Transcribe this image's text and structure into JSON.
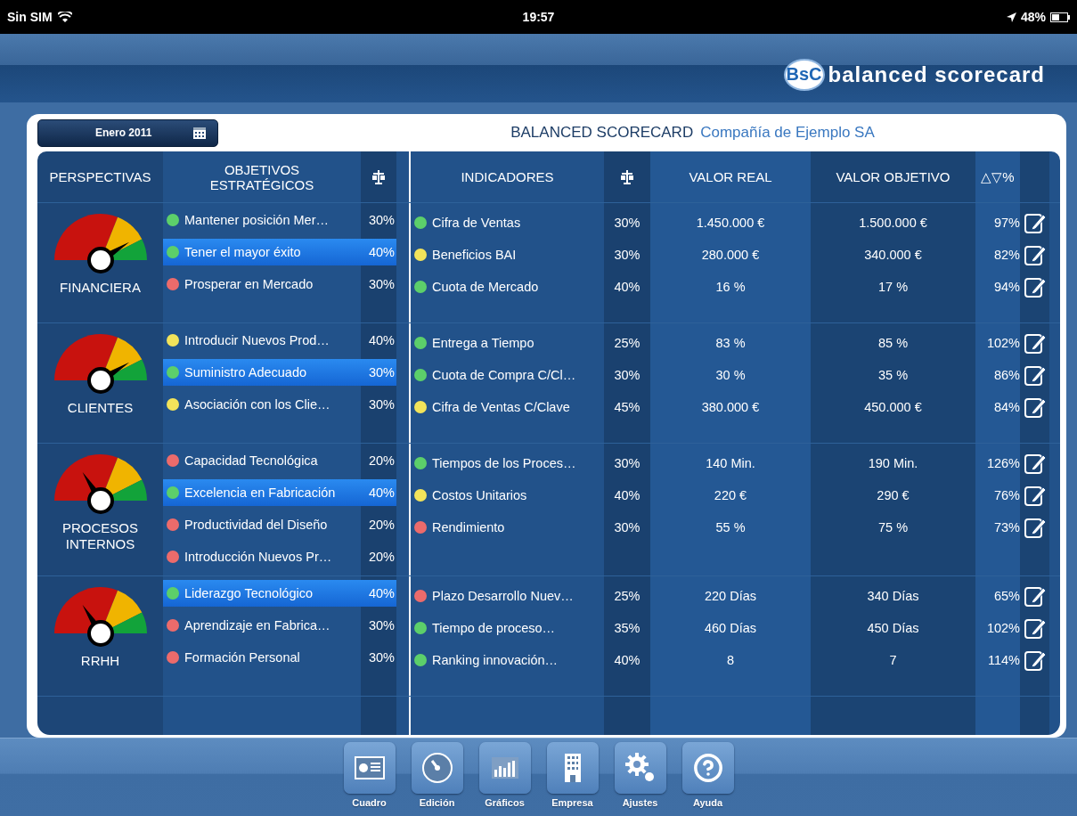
{
  "status_bar": {
    "carrier": "Sin SIM",
    "time": "19:57",
    "battery": "48%"
  },
  "header": {
    "logo_badge": "BsC",
    "logo_text": "balanced scorecard"
  },
  "date_button": "Enero 2011",
  "title": {
    "main": "BALANCED SCORECARD",
    "company": "Compañía de Ejemplo SA"
  },
  "columns": {
    "perspectives": "PERSPECTIVAS",
    "objectives": "OBJETIVOS ESTRATÉGICOS",
    "indicators": "INDICADORES",
    "real": "VALOR REAL",
    "target": "VALOR OBJETIVO",
    "delta": "△▽%"
  },
  "groups": [
    {
      "perspective": "FINANCIERA",
      "kind": "high",
      "objectives": [
        {
          "name": "Mantener posición Mer…",
          "weight": "30%",
          "color": "#5ccf6a",
          "selected": false
        },
        {
          "name": "Tener el mayor éxito",
          "weight": "40%",
          "color": "#5ccf6a",
          "selected": true
        },
        {
          "name": "Prosperar en Mercado",
          "weight": "30%",
          "color": "#ec6b6b",
          "selected": false
        }
      ],
      "indicators": [
        {
          "name": "Cifra de Ventas",
          "weight": "30%",
          "real": "1.450.000 €",
          "target": "1.500.000 €",
          "pct": "97%",
          "color": "#5ccf6a"
        },
        {
          "name": "Beneficios BAI",
          "weight": "30%",
          "real": "280.000 €",
          "target": "340.000 €",
          "pct": "82%",
          "color": "#f2e35a"
        },
        {
          "name": "Cuota de Mercado",
          "weight": "40%",
          "real": "16 %",
          "target": "17 %",
          "pct": "94%",
          "color": "#5ccf6a"
        }
      ]
    },
    {
      "perspective": "CLIENTES",
      "kind": "high",
      "objectives": [
        {
          "name": "Introducir Nuevos Prod…",
          "weight": "40%",
          "color": "#f2e35a",
          "selected": false
        },
        {
          "name": "Suministro Adecuado",
          "weight": "30%",
          "color": "#5ccf6a",
          "selected": true
        },
        {
          "name": "Asociación con los Clie…",
          "weight": "30%",
          "color": "#f2e35a",
          "selected": false
        }
      ],
      "indicators": [
        {
          "name": "Entrega a Tiempo",
          "weight": "25%",
          "real": "83 %",
          "target": "85 %",
          "pct": "102%",
          "color": "#5ccf6a"
        },
        {
          "name": "Cuota de Compra C/Cl…",
          "weight": "30%",
          "real": "30 %",
          "target": "35 %",
          "pct": "86%",
          "color": "#5ccf6a"
        },
        {
          "name": "Cifra de Ventas C/Clave",
          "weight": "45%",
          "real": "380.000 €",
          "target": "450.000 €",
          "pct": "84%",
          "color": "#f2e35a"
        }
      ]
    },
    {
      "perspective": "PROCESOS INTERNOS",
      "kind": "low",
      "objectives": [
        {
          "name": "Capacidad Tecnológica",
          "weight": "20%",
          "color": "#ec6b6b",
          "selected": false
        },
        {
          "name": "Excelencia en Fabricación",
          "weight": "40%",
          "color": "#5ccf6a",
          "selected": true
        },
        {
          "name": "Productividad del Diseño",
          "weight": "20%",
          "color": "#ec6b6b",
          "selected": false
        },
        {
          "name": "Introducción Nuevos Pr…",
          "weight": "20%",
          "color": "#ec6b6b",
          "selected": false
        }
      ],
      "indicators": [
        {
          "name": "Tiempos de los Proces…",
          "weight": "30%",
          "real": "140 Min.",
          "target": "190 Min.",
          "pct": "126%",
          "color": "#5ccf6a"
        },
        {
          "name": "Costos Unitarios",
          "weight": "40%",
          "real": "220 €",
          "target": "290 €",
          "pct": "76%",
          "color": "#f2e35a"
        },
        {
          "name": "Rendimiento",
          "weight": "30%",
          "real": "55 %",
          "target": "75 %",
          "pct": "73%",
          "color": "#ec6b6b"
        }
      ]
    },
    {
      "perspective": "RRHH",
      "kind": "low",
      "objectives": [
        {
          "name": "Liderazgo Tecnológico",
          "weight": "40%",
          "color": "#5ccf6a",
          "selected": true
        },
        {
          "name": "Aprendizaje en Fabrica…",
          "weight": "30%",
          "color": "#ec6b6b",
          "selected": false
        },
        {
          "name": "Formación Personal",
          "weight": "30%",
          "color": "#ec6b6b",
          "selected": false
        }
      ],
      "indicators": [
        {
          "name": "Plazo Desarrollo Nuev…",
          "weight": "25%",
          "real": "220 Días",
          "target": "340 Días",
          "pct": "65%",
          "color": "#ec6b6b"
        },
        {
          "name": "Tiempo de proceso…",
          "weight": "35%",
          "real": "460 Días",
          "target": "450 Días",
          "pct": "102%",
          "color": "#5ccf6a"
        },
        {
          "name": "Ranking innovación…",
          "weight": "40%",
          "real": "8",
          "target": "7",
          "pct": "114%",
          "color": "#5ccf6a"
        }
      ]
    }
  ],
  "toolbar": [
    {
      "label": "Cuadro",
      "kind": "card"
    },
    {
      "label": "Edición",
      "kind": "gauge"
    },
    {
      "label": "Gráficos",
      "kind": "chart"
    },
    {
      "label": "Empresa",
      "kind": "building"
    },
    {
      "label": "Ajustes",
      "kind": "gears"
    },
    {
      "label": "Ayuda",
      "kind": "help"
    }
  ]
}
